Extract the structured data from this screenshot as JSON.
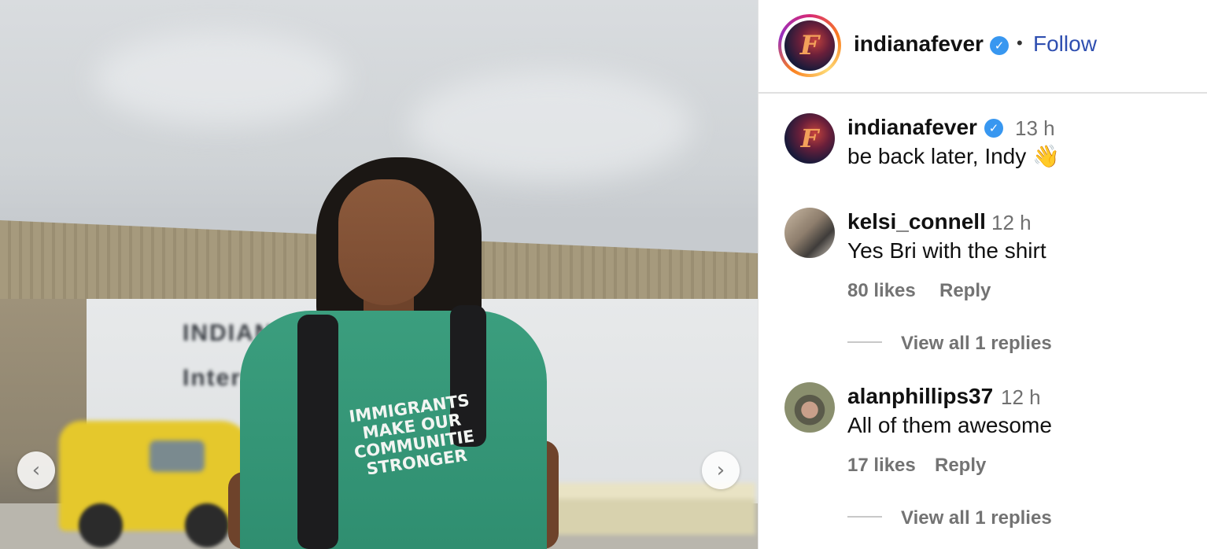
{
  "photo": {
    "wall_sign_lines": [
      "INDIANA",
      "Intern"
    ],
    "shirt_text_lines": [
      "IMMIGRANTS",
      "MAKE OUR",
      "COMMUNITIE",
      "STRONGER"
    ],
    "prev_icon": "chevron-left-icon",
    "prev_glyph": "‹",
    "next_icon": "chevron-right-icon",
    "next_glyph": "›"
  },
  "header": {
    "username": "indianafever",
    "verified_glyph": "✓",
    "separator": "•",
    "follow_label": "Follow",
    "logo_letter": "F"
  },
  "comments": [
    {
      "username": "indianafever",
      "verified": true,
      "time": "13 h",
      "text": "be back later, Indy 👋"
    },
    {
      "username": "kelsi_connell",
      "time": "12 h",
      "text": "Yes Bri with the shirt",
      "likes": "80 likes",
      "reply_label": "Reply",
      "view_replies": "View all 1 replies"
    },
    {
      "username": "alanphillips37",
      "time": "12 h",
      "text": "All of them awesome",
      "likes": "17 likes",
      "reply_label": "Reply",
      "view_replies": "View all 1 replies"
    }
  ],
  "colors": {
    "follow": "#2f4fb0",
    "verified": "#3897f0",
    "meta_text": "#737373"
  }
}
